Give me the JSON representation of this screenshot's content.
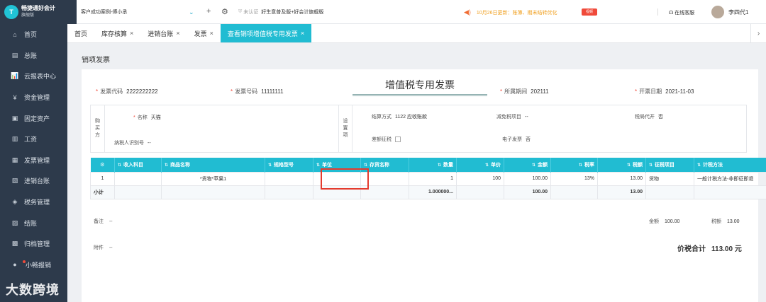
{
  "app": {
    "name": "畅捷通好会计",
    "edition": "旗舰版",
    "logo_text": "T"
  },
  "topbar": {
    "account": "客户成功案例-傅小承",
    "cert_status": "未认证",
    "edition_note": "好生意普及版+好会计旗舰版",
    "notice": "10月26日更新：账簿、期末结转优化",
    "video_badge": "视频",
    "service": "在线客服",
    "user": "李四代1"
  },
  "sidebar": {
    "items": [
      {
        "label": "首页",
        "icon": "home-icon",
        "glyph": "⌂"
      },
      {
        "label": "总账",
        "icon": "ledger-icon",
        "glyph": "▤"
      },
      {
        "label": "云报表中心",
        "icon": "report-icon",
        "glyph": "📊"
      },
      {
        "label": "资金管理",
        "icon": "money-icon",
        "glyph": "¥"
      },
      {
        "label": "固定资产",
        "icon": "asset-icon",
        "glyph": "▣"
      },
      {
        "label": "工资",
        "icon": "salary-icon",
        "glyph": "▥"
      },
      {
        "label": "发票管理",
        "icon": "invoice-icon",
        "glyph": "▦"
      },
      {
        "label": "进销台账",
        "icon": "account-book-icon",
        "glyph": "▧"
      },
      {
        "label": "税务管理",
        "icon": "tax-icon",
        "glyph": "◈"
      },
      {
        "label": "结账",
        "icon": "close-book-icon",
        "glyph": "▨"
      },
      {
        "label": "归档管理",
        "icon": "archive-icon",
        "glyph": "▩"
      },
      {
        "label": "小畅报销",
        "icon": "expense-icon",
        "glyph": "●"
      }
    ]
  },
  "tabs": [
    {
      "label": "首页",
      "closable": false,
      "active": false
    },
    {
      "label": "库存核算",
      "closable": true,
      "active": false
    },
    {
      "label": "进销台账",
      "closable": true,
      "active": false
    },
    {
      "label": "发票",
      "closable": true,
      "active": false
    },
    {
      "label": "查看销项增值税专用发票",
      "closable": true,
      "active": true
    }
  ],
  "page": {
    "title": "销项发票"
  },
  "invoice": {
    "title": "增值税专用发票",
    "code_label": "发票代码",
    "code": "2222222222",
    "number_label": "发票号码",
    "number": "11111111",
    "period_label": "所属期间",
    "period": "202111",
    "date_label": "开票日期",
    "date": "2021-11-03",
    "buyer_vlabel": [
      "购",
      "买",
      "方"
    ],
    "name_label": "名称",
    "name": "天猫",
    "taxid_label": "纳税人识别号",
    "taxid": "--",
    "settings_vlabel": [
      "设",
      "置",
      "项"
    ],
    "settle_label": "结算方式",
    "settle": "1122 应收账款",
    "exempt_label": "减免税项目",
    "exempt": "--",
    "agent_label": "税局代开",
    "agent": "否",
    "diff_label": "差额征税",
    "einv_label": "电子发票",
    "einv": "否"
  },
  "table": {
    "columns": [
      "⚙",
      "收入科目",
      "商品名称",
      "规格型号",
      "单位",
      "存货名称",
      "数量",
      "单价",
      "金额",
      "税率",
      "税额",
      "征税项目",
      "计税方法"
    ],
    "rows": [
      [
        "1",
        "",
        "*货物*苹果1",
        "",
        "",
        "",
        "1",
        "100",
        "100.00",
        "13%",
        "13.00",
        "货物",
        "一般计税方法-非即征即退"
      ]
    ],
    "subtotal": [
      "小计",
      "",
      "",
      "",
      "",
      "",
      "1.000000...",
      "",
      "100.00",
      "",
      "13.00",
      "",
      ""
    ]
  },
  "footer": {
    "remark_label": "备注",
    "remark": "--",
    "amount_label": "金额",
    "amount": "100.00",
    "tax_label": "税额",
    "tax": "13.00",
    "attach_label": "附件",
    "attach": "--",
    "total_label": "价税合计",
    "total": "113.00 元"
  },
  "watermark": "大数跨境"
}
